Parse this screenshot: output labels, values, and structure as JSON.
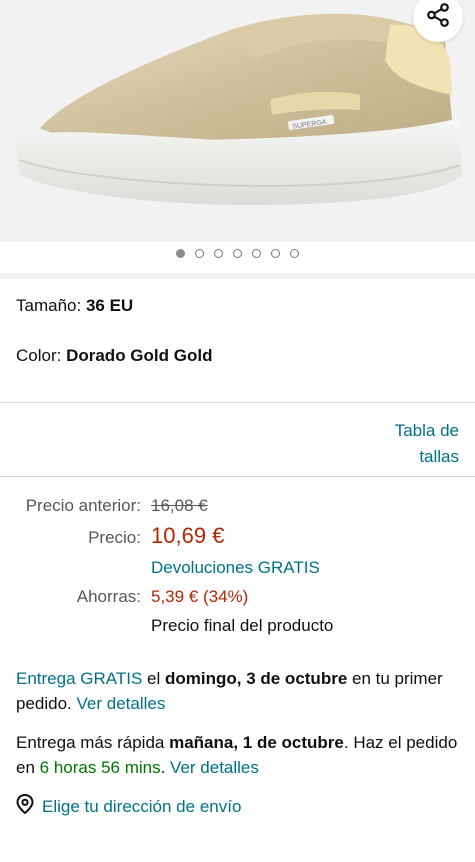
{
  "product": {
    "image_alt": "Zapatilla slip-on dorada",
    "brand_mark": "SUPERGA",
    "image_count": 7,
    "active_image": 1
  },
  "variant": {
    "size_label": "Tamaño: ",
    "size_value": "36 EU",
    "color_label": "Color: ",
    "color_value": "Dorado Gold Gold",
    "size_chart_line1": "Tabla de",
    "size_chart_line2": "tallas"
  },
  "pricing": {
    "previous_label": "Precio anterior:",
    "previous_value": "16,08 €",
    "price_label": "Precio:",
    "price_value": "10,69 €",
    "returns": "Devoluciones GRATIS",
    "savings_label": "Ahorras:",
    "savings_value": "5,39 € (34%)",
    "final_note": "Precio final del producto"
  },
  "delivery": {
    "free_prefix": "Entrega GRATIS",
    "free_el": " el ",
    "free_date": "domingo, 3 de octubre",
    "free_suffix": " en tu primer pedido. ",
    "details_link": "Ver detalles",
    "fast_prefix": "Entrega más rápida ",
    "fast_date": "mañana, 1 de octubre",
    "fast_mid": ". Haz el pedido en ",
    "fast_countdown": "6 horas 56 mins",
    "fast_sep": ". ",
    "details_link2": "Ver detalles",
    "address_link": "Elige tu dirección de envío"
  },
  "colors": {
    "link": "#007185",
    "price_red": "#b12704",
    "stock_green": "#007600"
  },
  "icons": {
    "share": "share-icon",
    "location": "location-pin-icon"
  }
}
